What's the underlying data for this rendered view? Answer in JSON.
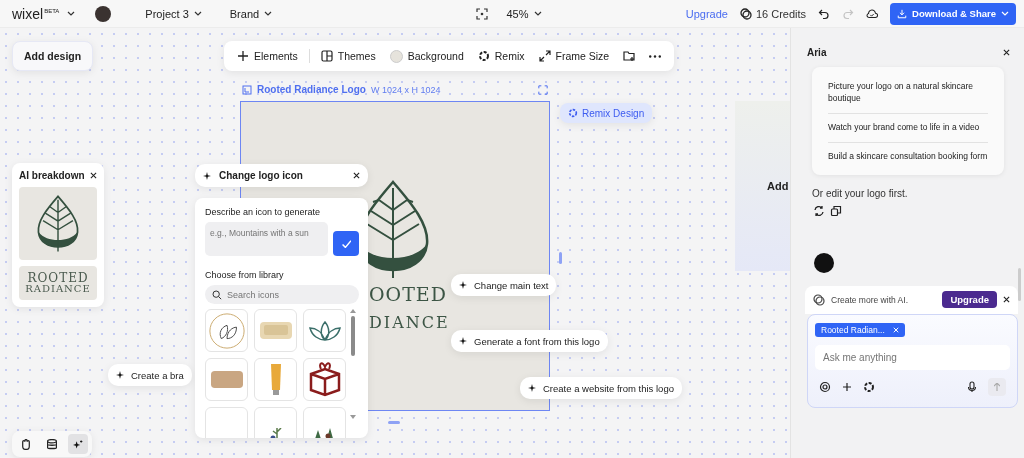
{
  "top_bar": {
    "brand": "wixel",
    "brand_badge": "BETA",
    "project": "Project 3",
    "section": "Brand",
    "zoom": "45%",
    "upgrade": "Upgrade",
    "credits": "16 Credits",
    "undo_disabled": false,
    "redo_disabled": true,
    "download": "Download & Share"
  },
  "canvas": {
    "add_design": "Add design",
    "toolbar": [
      {
        "kind": "elements",
        "label": "Elements"
      },
      {
        "kind": "themes",
        "label": "Themes"
      },
      {
        "kind": "background",
        "label": "Background"
      },
      {
        "kind": "remix",
        "label": "Remix"
      },
      {
        "kind": "frame-size",
        "label": "Frame Size"
      },
      {
        "kind": "folder"
      },
      {
        "kind": "more"
      }
    ],
    "frame": {
      "title": "Rooted Radiance Logo",
      "size": "W 1024 x H 1024",
      "logo_lines": [
        "OOTED",
        "DIANCE"
      ]
    },
    "remix": "Remix Design",
    "ghost_card": "Add",
    "ai_breakdown": {
      "title": "AI breakdown",
      "wordmark": [
        "ROOTED",
        "RADIANCE"
      ]
    },
    "change_icon": {
      "title": "Change logo icon",
      "prompt_label": "Describe an icon to generate",
      "placeholder": "e.g., Mountains with a sun",
      "library_label": "Choose from library",
      "search_placeholder": "Search icons"
    },
    "chips": [
      {
        "label": "Create a bra"
      },
      {
        "label": "Change main text"
      },
      {
        "label": "Generate a font from this logo"
      },
      {
        "label": "Create a website from this logo"
      }
    ],
    "tools": [
      {
        "kind": "hand",
        "selected": false
      },
      {
        "kind": "layers",
        "selected": false
      },
      {
        "kind": "ai",
        "selected": true
      }
    ]
  },
  "assistant": {
    "title": "Aria",
    "suggestions": [
      "Picture your logo on a natural skincare boutique",
      "Watch your brand come to life in a video",
      "Build a skincare consultation booking form"
    ],
    "note": "Or edit your logo first.",
    "promo": "Create more with AI.",
    "promo_button": "Upgrade",
    "attachment": "Rooted Radian...",
    "placeholder": "Ask me anything"
  }
}
